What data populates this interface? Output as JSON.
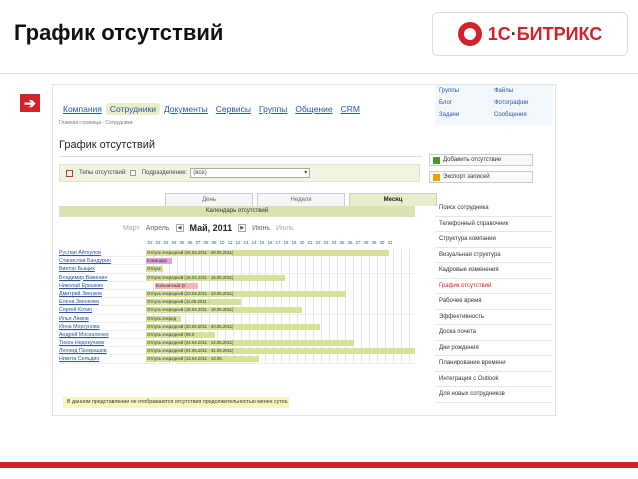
{
  "slide": {
    "title": "График отсутствий",
    "logo": {
      "brand": "1С",
      "dot": "·",
      "name": "БИТРИКС"
    }
  },
  "app": {
    "nav": [
      "Компания",
      "Сотрудники",
      "Документы",
      "Сервисы",
      "Группы",
      "Общение",
      "CRM"
    ],
    "active_nav": "Сотрудники",
    "breadcrumb": "Главная страница  ·  Сотрудники",
    "page_title": "График отсутствий",
    "filter": {
      "types_label": "Типы отсутствий:",
      "dept_label": "Подразделение:",
      "dept_value": "(все)"
    },
    "view_tabs": [
      "День",
      "Неделя",
      "Месяц"
    ],
    "active_view": "Месяц",
    "calendar_header": "Календарь отсутствий",
    "months": {
      "prev2": "Март",
      "prev": "Апрель",
      "current": "Май, 2011",
      "next": "Июнь",
      "next2": "Июль"
    },
    "days": [
      "01",
      "02",
      "03",
      "04",
      "05",
      "06",
      "07",
      "08",
      "09",
      "10",
      "11",
      "12",
      "13",
      "14",
      "15",
      "16",
      "17",
      "18",
      "19",
      "20",
      "21",
      "22",
      "23",
      "24",
      "25",
      "26",
      "27",
      "28",
      "29",
      "30",
      "31"
    ],
    "employees": [
      {
        "name": "Руслан Айткулов",
        "bar": "Отпуск очередной (26.04.2011 - 28.05.2011)",
        "start": 0,
        "end": 28,
        "color": "#d4e29a"
      },
      {
        "name": "Станислав Бандурин",
        "bar": "Командир",
        "start": 0,
        "end": 3,
        "color": "#e9a4dc"
      },
      {
        "name": "Виктор Быщих",
        "bar": "Отпуск",
        "start": 0,
        "end": 2,
        "color": "#d4e29a"
      },
      {
        "name": "Владимир Важенин",
        "bar": "Отпуск очередной (16.04.2011 - 16.05.2011)",
        "start": 0,
        "end": 16,
        "color": "#d4e29a"
      },
      {
        "name": "Николай Ерешкин",
        "bar": "Больничный (0",
        "start": 1,
        "end": 6,
        "color": "#f4b6b6"
      },
      {
        "name": "Дмитрий Звенков",
        "bar": "Отпуск очередной (23.04.2011 - 23.05.2011)",
        "start": 0,
        "end": 23,
        "color": "#d4e29a"
      },
      {
        "name": "Елена Звенкова",
        "bar": "Отпуск очередной (11.06.2011 -",
        "start": 0,
        "end": 11,
        "color": "#d4e29a"
      },
      {
        "name": "Сергей Котин",
        "bar": "Отпуск очередной (18.04.2011 - 18.05.2011)",
        "start": 0,
        "end": 18,
        "color": "#d4e29a"
      },
      {
        "name": "Илья Лямов",
        "bar": "Отпуск очеред",
        "start": 0,
        "end": 4,
        "color": "#d4e29a"
      },
      {
        "name": "Инна Моргунова",
        "bar": "Отпуск очередной (20.04.2011 - 20.05.2011)",
        "start": 0,
        "end": 20,
        "color": "#d4e29a"
      },
      {
        "name": "Андрей Москаленко",
        "bar": "Отпуск очередной (08.0",
        "start": 0,
        "end": 8,
        "color": "#d4e29a"
      },
      {
        "name": "Тихон Недокучаев",
        "bar": "Отпуск очередной (24.04.2011 - 24.05.2011)",
        "start": 0,
        "end": 24,
        "color": "#d4e29a"
      },
      {
        "name": "Леонид Панкрашев",
        "bar": "Отпуск очередной (01.05.2011 - 31.05.2011)",
        "start": 0,
        "end": 31,
        "color": "#d4e29a"
      },
      {
        "name": "Никита Сельдин",
        "bar": "Отпуск очередной (13.04.2011 - 13.05.",
        "start": 0,
        "end": 13,
        "color": "#d4e29a"
      }
    ],
    "note": "В данном представлении не отображаются отсутствия продолжительностью менее суток.",
    "top_links": [
      [
        "Группы",
        "Файлы"
      ],
      [
        "Блог",
        "Фотографии"
      ],
      [
        "Задачи",
        "Сообщения"
      ]
    ],
    "side_buttons": [
      {
        "label": "Добавить отсутствие",
        "color": "#4a9a2a"
      },
      {
        "label": "Экспорт записей",
        "color": "#f0a000"
      }
    ],
    "side_menu": [
      "Поиск сотрудника",
      "Телефонный справочник",
      "Структура компании",
      "Визуальная структура",
      "Кадровые изменения",
      "График отсутствий",
      "Рабочее время",
      "Эффективность",
      "Доска почета",
      "Дни рождения",
      "Планирование времени",
      "Интеграция с Outlook",
      "Для новых сотрудников"
    ],
    "active_menu": "График отсутствий"
  },
  "colors": {
    "accent": "#d2232a",
    "link": "#2a55a0",
    "bar": "#d4e29a"
  }
}
